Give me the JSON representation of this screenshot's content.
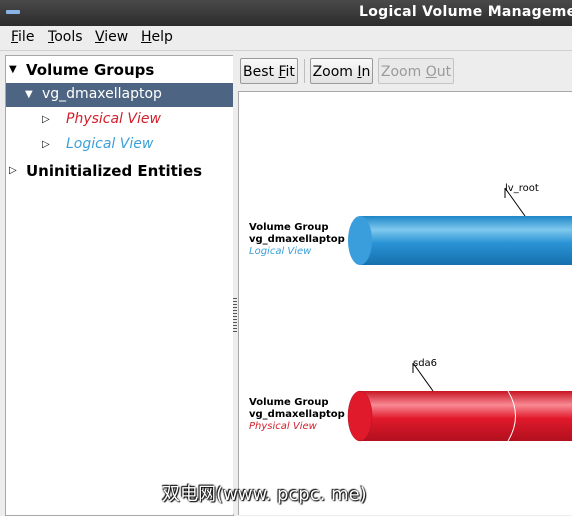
{
  "window": {
    "title": "Logical Volume Management"
  },
  "menu": [
    {
      "underline": "F",
      "rest": "ile"
    },
    {
      "underline": "T",
      "rest": "ools"
    },
    {
      "underline": "V",
      "rest": "iew"
    },
    {
      "underline": "H",
      "rest": "elp"
    }
  ],
  "tree": {
    "volume_groups": "Volume Groups",
    "vg_name": "vg_dmaxellaptop",
    "physical_view": "Physical View",
    "logical_view": "Logical View",
    "uninitialized": "Uninitialized Entities"
  },
  "toolbar": {
    "best_fit": {
      "pre": "Best ",
      "u": "F",
      "post": "it"
    },
    "zoom_in": {
      "pre": "Zoom ",
      "u": "I",
      "post": "n"
    },
    "zoom_out": {
      "pre": "Zoom ",
      "u": "O",
      "post": "ut"
    }
  },
  "canvas": {
    "logical": {
      "line1": "Volume Group",
      "line2": "vg_dmaxellaptop",
      "line3": "Logical View",
      "callout": "lv_root",
      "color": "#2a93d5"
    },
    "physical": {
      "line1": "Volume Group",
      "line2": "vg_dmaxellaptop",
      "line3": "Physical View",
      "callout": "sda6",
      "color": "#e0192b"
    }
  },
  "watermark": "双电网(www. pcpc. me)"
}
